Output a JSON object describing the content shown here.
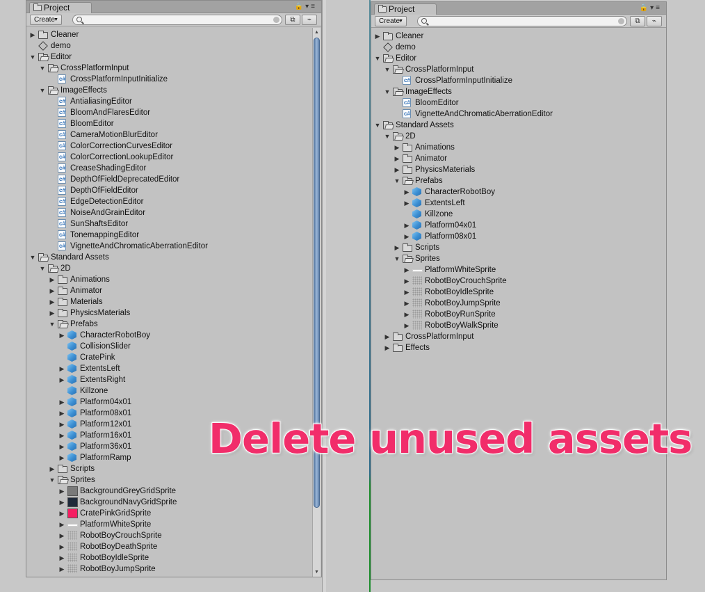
{
  "left_panel": {
    "tab_title": "Project",
    "create_label": "Create",
    "search_value": "",
    "tree": [
      {
        "label": "Cleaner",
        "level": 0,
        "arrow": "closed",
        "icon": "folder"
      },
      {
        "label": "demo",
        "level": 0,
        "arrow": "none",
        "icon": "unity-scene"
      },
      {
        "label": "Editor",
        "level": 0,
        "arrow": "open",
        "icon": "folder-open"
      },
      {
        "label": "CrossPlatformInput",
        "level": 1,
        "arrow": "open",
        "icon": "folder-open"
      },
      {
        "label": "CrossPlatformInputInitialize",
        "level": 2,
        "arrow": "none",
        "icon": "script"
      },
      {
        "label": "ImageEffects",
        "level": 1,
        "arrow": "open",
        "icon": "folder-open"
      },
      {
        "label": "AntialiasingEditor",
        "level": 2,
        "arrow": "none",
        "icon": "script"
      },
      {
        "label": "BloomAndFlaresEditor",
        "level": 2,
        "arrow": "none",
        "icon": "script"
      },
      {
        "label": "BloomEditor",
        "level": 2,
        "arrow": "none",
        "icon": "script"
      },
      {
        "label": "CameraMotionBlurEditor",
        "level": 2,
        "arrow": "none",
        "icon": "script"
      },
      {
        "label": "ColorCorrectionCurvesEditor",
        "level": 2,
        "arrow": "none",
        "icon": "script"
      },
      {
        "label": "ColorCorrectionLookupEditor",
        "level": 2,
        "arrow": "none",
        "icon": "script"
      },
      {
        "label": "CreaseShadingEditor",
        "level": 2,
        "arrow": "none",
        "icon": "script"
      },
      {
        "label": "DepthOfFieldDeprecatedEditor",
        "level": 2,
        "arrow": "none",
        "icon": "script"
      },
      {
        "label": "DepthOfFieldEditor",
        "level": 2,
        "arrow": "none",
        "icon": "script"
      },
      {
        "label": "EdgeDetectionEditor",
        "level": 2,
        "arrow": "none",
        "icon": "script"
      },
      {
        "label": "NoiseAndGrainEditor",
        "level": 2,
        "arrow": "none",
        "icon": "script"
      },
      {
        "label": "SunShaftsEditor",
        "level": 2,
        "arrow": "none",
        "icon": "script"
      },
      {
        "label": "TonemappingEditor",
        "level": 2,
        "arrow": "none",
        "icon": "script"
      },
      {
        "label": "VignetteAndChromaticAberrationEditor",
        "level": 2,
        "arrow": "none",
        "icon": "script"
      },
      {
        "label": "Standard Assets",
        "level": 0,
        "arrow": "open",
        "icon": "folder-open"
      },
      {
        "label": "2D",
        "level": 1,
        "arrow": "open",
        "icon": "folder-open"
      },
      {
        "label": "Animations",
        "level": 2,
        "arrow": "closed",
        "icon": "folder"
      },
      {
        "label": "Animator",
        "level": 2,
        "arrow": "closed",
        "icon": "folder"
      },
      {
        "label": "Materials",
        "level": 2,
        "arrow": "closed",
        "icon": "folder"
      },
      {
        "label": "PhysicsMaterials",
        "level": 2,
        "arrow": "closed",
        "icon": "folder"
      },
      {
        "label": "Prefabs",
        "level": 2,
        "arrow": "open",
        "icon": "folder-open"
      },
      {
        "label": "CharacterRobotBoy",
        "level": 3,
        "arrow": "closed",
        "icon": "prefab"
      },
      {
        "label": "CollisionSlider",
        "level": 3,
        "arrow": "none",
        "icon": "prefab"
      },
      {
        "label": "CratePink",
        "level": 3,
        "arrow": "none",
        "icon": "prefab"
      },
      {
        "label": "ExtentsLeft",
        "level": 3,
        "arrow": "closed",
        "icon": "prefab"
      },
      {
        "label": "ExtentsRight",
        "level": 3,
        "arrow": "closed",
        "icon": "prefab"
      },
      {
        "label": "Killzone",
        "level": 3,
        "arrow": "none",
        "icon": "prefab"
      },
      {
        "label": "Platform04x01",
        "level": 3,
        "arrow": "closed",
        "icon": "prefab"
      },
      {
        "label": "Platform08x01",
        "level": 3,
        "arrow": "closed",
        "icon": "prefab"
      },
      {
        "label": "Platform12x01",
        "level": 3,
        "arrow": "closed",
        "icon": "prefab"
      },
      {
        "label": "Platform16x01",
        "level": 3,
        "arrow": "closed",
        "icon": "prefab"
      },
      {
        "label": "Platform36x01",
        "level": 3,
        "arrow": "closed",
        "icon": "prefab"
      },
      {
        "label": "PlatformRamp",
        "level": 3,
        "arrow": "closed",
        "icon": "prefab"
      },
      {
        "label": "Scripts",
        "level": 2,
        "arrow": "closed",
        "icon": "folder"
      },
      {
        "label": "Sprites",
        "level": 2,
        "arrow": "open",
        "icon": "folder-open"
      },
      {
        "label": "BackgroundGreyGridSprite",
        "level": 3,
        "arrow": "closed",
        "icon": "swatch",
        "color": "#7a7a7a"
      },
      {
        "label": "BackgroundNavyGridSprite",
        "level": 3,
        "arrow": "closed",
        "icon": "swatch",
        "color": "#1f2a3a"
      },
      {
        "label": "CratePinkGridSprite",
        "level": 3,
        "arrow": "closed",
        "icon": "swatch",
        "color": "#f51e62"
      },
      {
        "label": "PlatformWhiteSprite",
        "level": 3,
        "arrow": "closed",
        "icon": "white-bar"
      },
      {
        "label": "RobotBoyCrouchSprite",
        "level": 3,
        "arrow": "closed",
        "icon": "sprite-dots"
      },
      {
        "label": "RobotBoyDeathSprite",
        "level": 3,
        "arrow": "closed",
        "icon": "sprite-dots"
      },
      {
        "label": "RobotBoyIdleSprite",
        "level": 3,
        "arrow": "closed",
        "icon": "sprite-dots"
      },
      {
        "label": "RobotBoyJumpSprite",
        "level": 3,
        "arrow": "closed",
        "icon": "sprite-dots"
      }
    ]
  },
  "right_panel": {
    "tab_title": "Project",
    "create_label": "Create",
    "search_value": "",
    "tree": [
      {
        "label": "Cleaner",
        "level": 0,
        "arrow": "closed",
        "icon": "folder"
      },
      {
        "label": "demo",
        "level": 0,
        "arrow": "none",
        "icon": "unity-scene"
      },
      {
        "label": "Editor",
        "level": 0,
        "arrow": "open",
        "icon": "folder-open"
      },
      {
        "label": "CrossPlatformInput",
        "level": 1,
        "arrow": "open",
        "icon": "folder-open"
      },
      {
        "label": "CrossPlatformInputInitialize",
        "level": 2,
        "arrow": "none",
        "icon": "script"
      },
      {
        "label": "ImageEffects",
        "level": 1,
        "arrow": "open",
        "icon": "folder-open"
      },
      {
        "label": "BloomEditor",
        "level": 2,
        "arrow": "none",
        "icon": "script"
      },
      {
        "label": "VignetteAndChromaticAberrationEditor",
        "level": 2,
        "arrow": "none",
        "icon": "script"
      },
      {
        "label": "Standard Assets",
        "level": 0,
        "arrow": "open",
        "icon": "folder-open"
      },
      {
        "label": "2D",
        "level": 1,
        "arrow": "open",
        "icon": "folder-open"
      },
      {
        "label": "Animations",
        "level": 2,
        "arrow": "closed",
        "icon": "folder"
      },
      {
        "label": "Animator",
        "level": 2,
        "arrow": "closed",
        "icon": "folder"
      },
      {
        "label": "PhysicsMaterials",
        "level": 2,
        "arrow": "closed",
        "icon": "folder"
      },
      {
        "label": "Prefabs",
        "level": 2,
        "arrow": "open",
        "icon": "folder-open"
      },
      {
        "label": "CharacterRobotBoy",
        "level": 3,
        "arrow": "closed",
        "icon": "prefab"
      },
      {
        "label": "ExtentsLeft",
        "level": 3,
        "arrow": "closed",
        "icon": "prefab"
      },
      {
        "label": "Killzone",
        "level": 3,
        "arrow": "none",
        "icon": "prefab"
      },
      {
        "label": "Platform04x01",
        "level": 3,
        "arrow": "closed",
        "icon": "prefab"
      },
      {
        "label": "Platform08x01",
        "level": 3,
        "arrow": "closed",
        "icon": "prefab"
      },
      {
        "label": "Scripts",
        "level": 2,
        "arrow": "closed",
        "icon": "folder"
      },
      {
        "label": "Sprites",
        "level": 2,
        "arrow": "open",
        "icon": "folder-open"
      },
      {
        "label": "PlatformWhiteSprite",
        "level": 3,
        "arrow": "closed",
        "icon": "white-bar"
      },
      {
        "label": "RobotBoyCrouchSprite",
        "level": 3,
        "arrow": "closed",
        "icon": "sprite-dots"
      },
      {
        "label": "RobotBoyIdleSprite",
        "level": 3,
        "arrow": "closed",
        "icon": "sprite-dots"
      },
      {
        "label": "RobotBoyJumpSprite",
        "level": 3,
        "arrow": "closed",
        "icon": "sprite-dots"
      },
      {
        "label": "RobotBoyRunSprite",
        "level": 3,
        "arrow": "closed",
        "icon": "sprite-dots"
      },
      {
        "label": "RobotBoyWalkSprite",
        "level": 3,
        "arrow": "closed",
        "icon": "sprite-dots"
      },
      {
        "label": "CrossPlatformInput",
        "level": 1,
        "arrow": "closed",
        "icon": "folder"
      },
      {
        "label": "Effects",
        "level": 1,
        "arrow": "closed",
        "icon": "folder"
      }
    ]
  },
  "overlay": {
    "caption": "Delete unused assets",
    "color": "#f12d6a"
  },
  "colors": {
    "panel_bg": "#c2c2c2",
    "scroll_thumb": "#7b9cc4"
  }
}
